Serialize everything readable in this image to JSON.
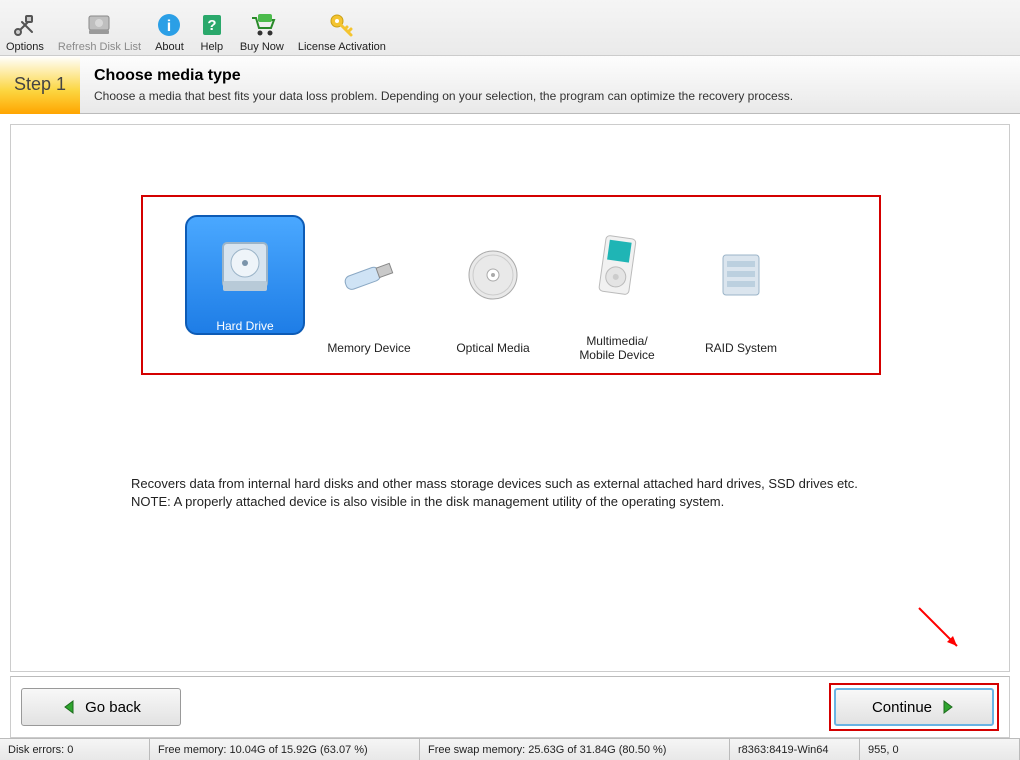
{
  "toolbar": {
    "options": "Options",
    "refresh": "Refresh Disk List",
    "about": "About",
    "help": "Help",
    "buy": "Buy Now",
    "license": "License Activation"
  },
  "step": {
    "badge": "Step 1",
    "title": "Choose media type",
    "subtitle": "Choose a media that best fits your data loss problem. Depending on your selection, the program can optimize the recovery process."
  },
  "media": {
    "hard_drive": "Hard Drive",
    "memory": "Memory Device",
    "optical": "Optical Media",
    "multimedia": "Multimedia/\nMobile Device",
    "raid": "RAID System"
  },
  "description": "Recovers data from internal hard disks and other mass storage devices such as external attached hard drives, SSD drives etc.\n NOTE: A properly attached device is also visible in the disk management utility of the operating system.",
  "buttons": {
    "back": "Go back",
    "continue": "Continue"
  },
  "status": {
    "disk_errors": "Disk errors: 0",
    "free_mem": "Free memory: 10.04G of 15.92G (63.07 %)",
    "free_swap": "Free swap memory: 25.63G of 31.84G (80.50 %)",
    "build": "r8363:8419-Win64",
    "coords": "955, 0"
  }
}
